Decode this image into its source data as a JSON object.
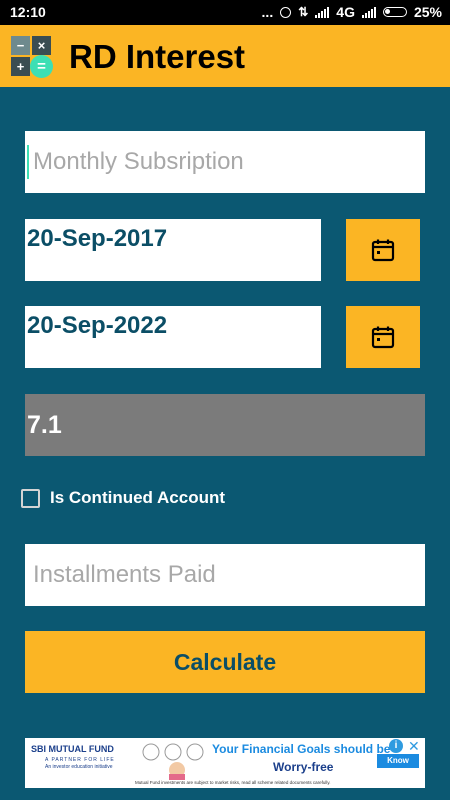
{
  "status_bar": {
    "time": "12:10",
    "dots": "...",
    "network": "4G",
    "battery": "25%"
  },
  "app_bar": {
    "title": "RD Interest",
    "icon_minus": "−",
    "icon_close": "×",
    "icon_plus": "+",
    "icon_equals": "="
  },
  "form": {
    "monthly_subscription_placeholder": "Monthly Subsription",
    "start_date": "20-Sep-2017",
    "end_date": "20-Sep-2022",
    "rate": "7.1",
    "continued_account_label": "Is Continued Account",
    "installments_paid_placeholder": "Installments Paid",
    "calculate_label": "Calculate"
  },
  "ad": {
    "brand": "SBI MUTUAL FUND",
    "tagline": "A PARTNER FOR LIFE",
    "subtagline": "An investor education initiative",
    "headline": "Your Financial Goals should be",
    "headline2": "Worry-free",
    "cta": "Know More",
    "disclaimer": "Mutual Fund investments are subject to market risks, read all scheme related documents carefully.",
    "info_glyph": "i",
    "close_glyph": "✕"
  },
  "colors": {
    "background": "#0b5872",
    "accent": "#fbb524",
    "text_dark_blue": "#0b4e66",
    "rate_field": "#7b7b7b",
    "icon_teal": "#3ddfb4"
  }
}
